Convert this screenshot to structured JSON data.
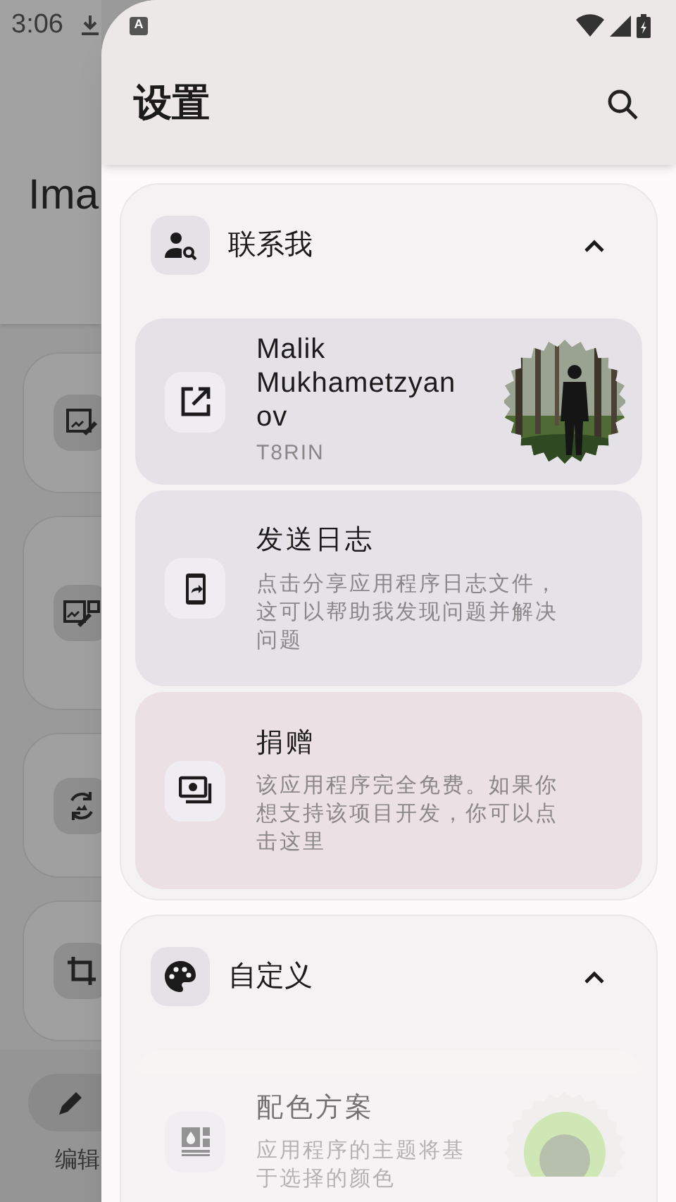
{
  "status_bar": {
    "time": "3:06",
    "notification_letter": "A"
  },
  "background_app": {
    "title": "Ima",
    "nav_label": "编辑"
  },
  "drawer": {
    "title": "设置",
    "sections": [
      {
        "title": "联系我",
        "expanded": true,
        "items": [
          {
            "kind": "author",
            "title": "Malik Mukhametzyanov",
            "subtitle": "T8RIN",
            "disabled": false
          },
          {
            "kind": "logs",
            "title": "发送日志",
            "description": "点击分享应用程序日志文件，这可以帮助我发现问题并解决问题",
            "disabled": false
          },
          {
            "kind": "donate",
            "title": "捐赠",
            "description": "该应用程序完全免费。如果你想支持该项目开发，你可以点击这里",
            "disabled": false
          }
        ]
      },
      {
        "title": "自定义",
        "expanded": true,
        "items": [
          {
            "kind": "color_scheme",
            "title": "配色方案",
            "description": "应用程序的主题将基于选择的颜色",
            "disabled": true
          }
        ]
      }
    ]
  }
}
